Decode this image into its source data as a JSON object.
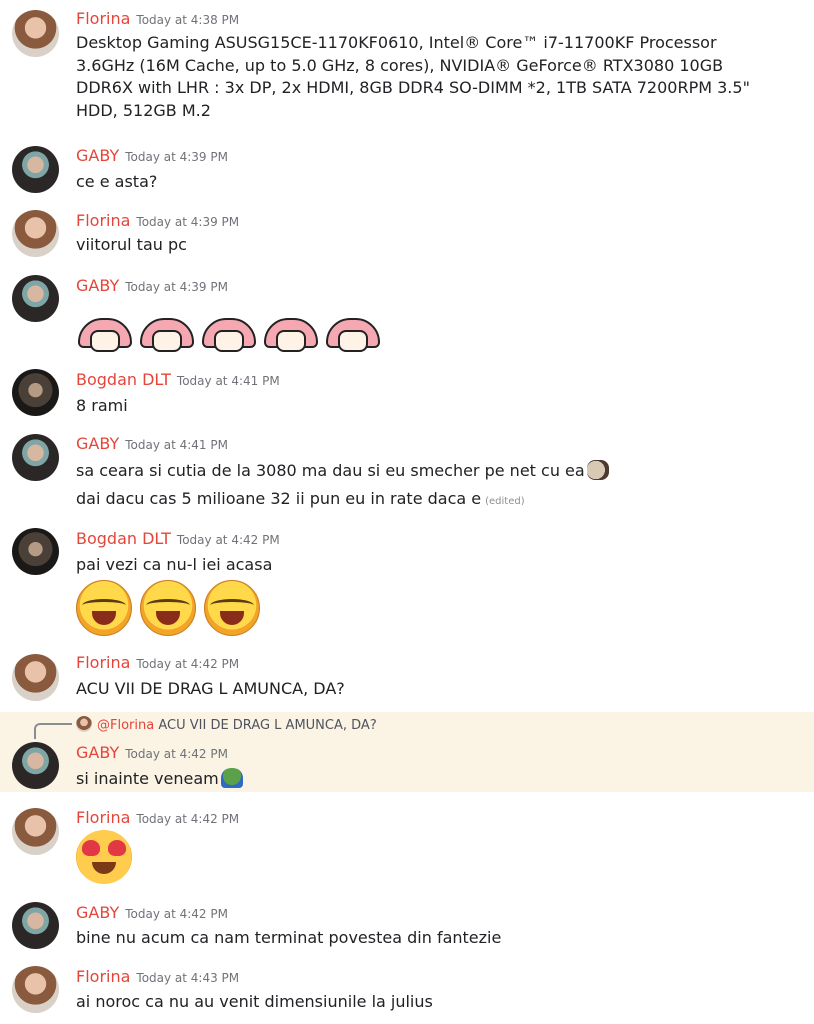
{
  "messages": [
    {
      "author": "Florina",
      "timestamp": "Today at 4:38 PM",
      "text": "Desktop Gaming ASUSG15CE-1170KF0610, Intel® Core™ i7-11700KF Processor 3.6GHz (16M Cache, up to 5.0 GHz, 8 cores), NVIDIA® GeForce® RTX3080  10GB DDR6X with LHR : 3x DP, 2x HDMI, 8GB DDR4 SO-DIMM *2, 1TB SATA 7200RPM 3.5\" HDD, 512GB M.2"
    },
    {
      "author": "GABY",
      "timestamp": "Today at 4:39 PM",
      "text": "ce e asta?"
    },
    {
      "author": "Florina",
      "timestamp": "Today at 4:39 PM",
      "text": "viitorul tau pc"
    },
    {
      "author": "GABY",
      "timestamp": "Today at 4:39 PM",
      "emojis": [
        "anime-girl-emoji",
        "anime-girl-emoji",
        "anime-girl-emoji",
        "anime-girl-emoji",
        "anime-girl-emoji"
      ]
    },
    {
      "author": "Bogdan DLT",
      "timestamp": "Today at 4:41 PM",
      "text": "8 rami"
    },
    {
      "author": "GABY",
      "timestamp": "Today at 4:41 PM",
      "text": "sa ceara si cutia de la 3080 ma dau si eu smecher pe net cu ea",
      "text2": "dai dacu cas 5 milioane 32 ii pun eu in rate daca e",
      "edited": "(edited)"
    },
    {
      "author": "Bogdan DLT",
      "timestamp": "Today at 4:42 PM",
      "text": "pai vezi ca nu-l iei acasa",
      "emojis": [
        "crying-laughing-emoji",
        "crying-laughing-emoji",
        "crying-laughing-emoji"
      ]
    },
    {
      "author": "Florina",
      "timestamp": "Today at 4:42 PM",
      "text": "ACU VII DE DRAG L AMUNCA, DA?"
    },
    {
      "author": "GABY",
      "timestamp": "Today at 4:42 PM",
      "text": "si inainte veneam",
      "reply": {
        "mention": "@Florina",
        "text": "ACU VII DE DRAG L AMUNCA, DA?"
      }
    },
    {
      "author": "Florina",
      "timestamp": "Today at 4:42 PM",
      "emojis": [
        "heart-eyes-emoji"
      ]
    },
    {
      "author": "GABY",
      "timestamp": "Today at 4:42 PM",
      "text": "bine nu acum ca nam terminat povestea din fantezie"
    },
    {
      "author": "Florina",
      "timestamp": "Today at 4:43 PM",
      "text": "ai noroc ca nu au venit dimensiunile la julius"
    }
  ],
  "colors": {
    "username": "#e5453a",
    "timestamp": "#6f7378",
    "reply_highlight": "#fbf3e4"
  }
}
